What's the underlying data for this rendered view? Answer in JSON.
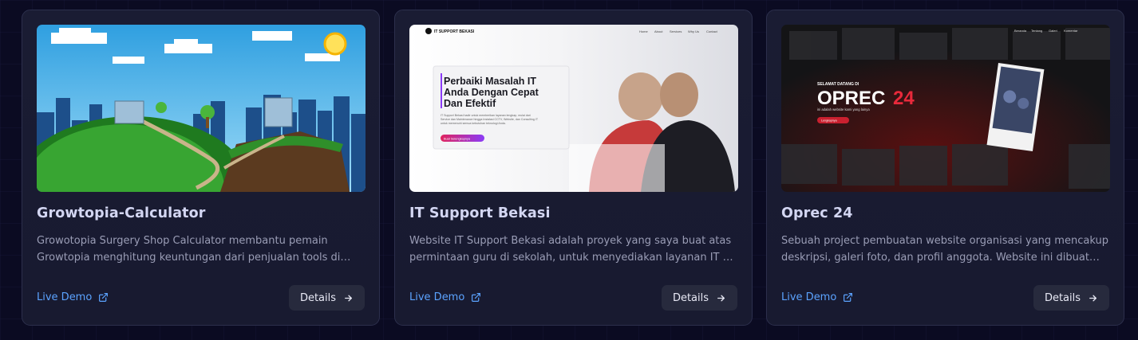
{
  "projects": [
    {
      "title": "Growtopia-Calculator",
      "description": "Growotopia Surgery Shop Calculator membantu pemain Growtopia menghitung keuntungan dari penjualan tools di Surgery Shop.",
      "live_label": "Live Demo",
      "details_label": "Details"
    },
    {
      "title": "IT Support Bekasi",
      "description": "Website IT Support Bekasi adalah proyek yang saya buat atas permintaan guru di sekolah, untuk menyediakan layanan IT di wilayah Bekasi.",
      "live_label": "Live Demo",
      "details_label": "Details",
      "preview": {
        "brand": "IT SUPPORT BEKASI",
        "nav": [
          "Home",
          "About",
          "Services",
          "Why Us",
          "Contact"
        ],
        "headline": [
          "Perbaiki Masalah IT",
          "Anda Dengan Cepat",
          "Dan Efektif"
        ],
        "body": [
          "IT Support Bekasi hadir untuk memberikan layanan lengkap, mulai dari",
          "Service dan Maintenance hingga Instalasi CCTV, Website, dan Consulting IT",
          "untuk memenuhi semua kebutuhan teknologi Anda."
        ],
        "cta": "Buat Selengkapnya"
      }
    },
    {
      "title": "Oprec 24",
      "description": "Sebuah project pembuatan website organisasi yang mencakup deskripsi, galeri foto, dan profil anggota. Website ini dibuat untuk open recruitment.",
      "live_label": "Live Demo",
      "details_label": "Details",
      "preview": {
        "nav": [
          "Beranda",
          "Tentang",
          "Galeri",
          "Komentar"
        ],
        "welcome": "SELAMAT DATANG DI",
        "title_white": "OPREC",
        "title_red": "24",
        "subtitle": "ini adalah website kami yang lainya",
        "cta": "Lengkapnya"
      }
    }
  ],
  "colors": {
    "link": "#5ba3ff",
    "accent_red": "#e8293b",
    "card_bg": "#1a1c33"
  }
}
